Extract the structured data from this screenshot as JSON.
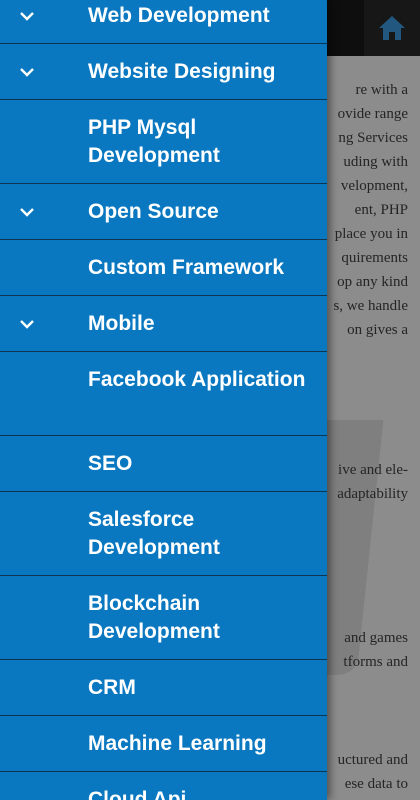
{
  "background": {
    "lines": [
      "re with a",
      "ovide range",
      "ng Services",
      "uding with",
      "velopment,",
      "ent, PHP",
      "place you in",
      "quirements",
      "op any kind",
      "s, we handle",
      "on gives a",
      "ive and ele-",
      "adaptability",
      "and games",
      "tforms and",
      "uctured and",
      "ese data to"
    ]
  },
  "drawer": {
    "items": [
      {
        "label": "Web Development",
        "expandable": true
      },
      {
        "label": "Website Designing",
        "expandable": true
      },
      {
        "label": "PHP Mysql Development",
        "expandable": false
      },
      {
        "label": "Open Source",
        "expandable": true
      },
      {
        "label": "Custom Framework",
        "expandable": false
      },
      {
        "label": "Mobile",
        "expandable": true
      },
      {
        "label": "Facebook Application",
        "expandable": false
      },
      {
        "label": "SEO",
        "expandable": false
      },
      {
        "label": "Salesforce Development",
        "expandable": false
      },
      {
        "label": "Blockchain Development",
        "expandable": false
      },
      {
        "label": "CRM",
        "expandable": false
      },
      {
        "label": "Machine Learning",
        "expandable": false
      },
      {
        "label": "Cloud Api",
        "expandable": false
      }
    ]
  },
  "colors": {
    "drawer_bg": "#0a78c0",
    "divider": "#0d3550",
    "text": "#ffffff",
    "topbar": "#1a1a1a"
  },
  "icons": {
    "home": "home-icon",
    "chevron": "chevron-down-icon"
  }
}
